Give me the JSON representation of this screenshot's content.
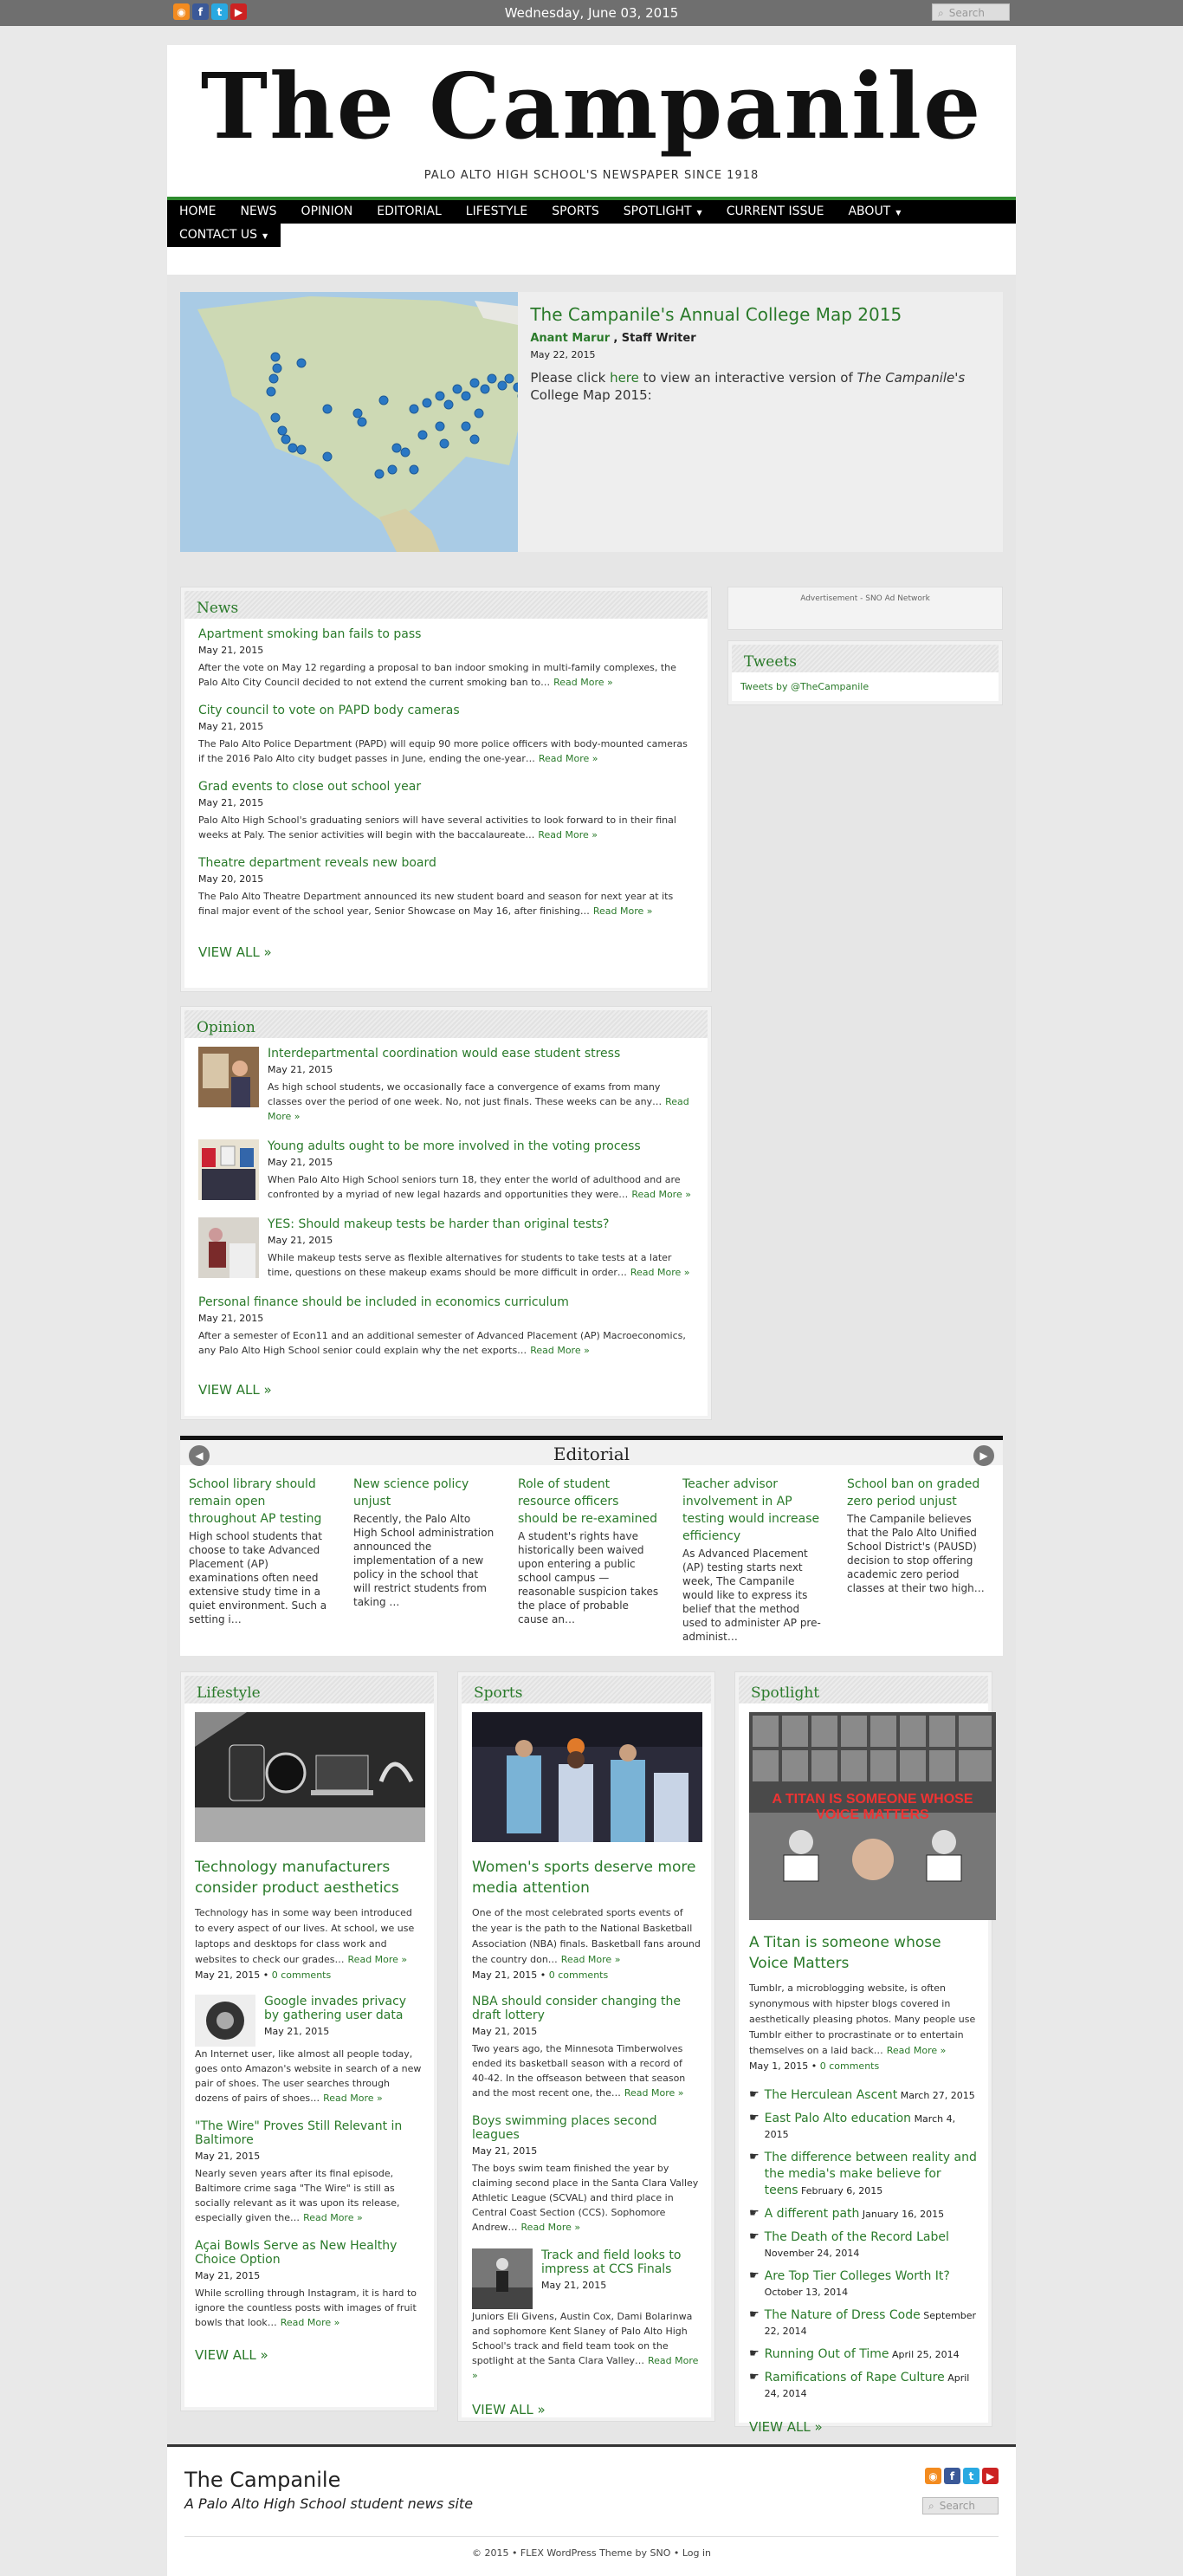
{
  "topbar": {
    "date": "Wednesday, June 03, 2015",
    "search_placeholder": "Search"
  },
  "site": {
    "title": "The Campanile",
    "tagline": "PALO ALTO HIGH SCHOOL'S NEWSPAPER SINCE 1918"
  },
  "nav": {
    "items": [
      "HOME",
      "NEWS",
      "OPINION",
      "EDITORIAL",
      "LIFESTYLE",
      "SPORTS",
      "SPOTLIGHT",
      "CURRENT ISSUE",
      "ABOUT",
      "CONTACT US"
    ]
  },
  "feature": {
    "title": "The Campanile's Annual College Map 2015",
    "author": "Anant Marur",
    "role": "Staff Writer",
    "date": "May 22, 2015",
    "body_pre": "Please click",
    "body_link": "here",
    "body_mid": "to view an interactive version of",
    "body_italic": "The Campanile's",
    "body_post": "College Map 2015:"
  },
  "news": {
    "header": "News",
    "articles": [
      {
        "title": "Apartment smoking ban fails to pass",
        "date": "May 21, 2015",
        "excerpt": "After the vote on May 12 regarding a proposal to ban indoor smoking in multi-family complexes, the Palo Alto City Council decided to not extend the current smoking ban to…"
      },
      {
        "title": "City council to vote on PAPD body cameras",
        "date": "May 21, 2015",
        "excerpt": "The Palo Alto Police Department (PAPD) will equip 90 more police officers with body-mounted cameras if the 2016 Palo Alto city budget passes in June, ending the one-year…"
      },
      {
        "title": "Grad events to close out school year",
        "date": "May 21, 2015",
        "excerpt": "Palo Alto High School's graduating seniors will have several activities to look forward to in their final weeks at Paly. The senior activities will begin with the baccalaureate…"
      },
      {
        "title": "Theatre department reveals new board",
        "date": "May 20, 2015",
        "excerpt": "The Palo Alto Theatre Department announced its new student board and season for next year at its final major event of the school year, Senior Showcase on May 16, after finishing…"
      }
    ]
  },
  "opinion": {
    "header": "Opinion",
    "articles": [
      {
        "title": "Interdepartmental coordination would ease student stress",
        "date": "May 21, 2015",
        "excerpt": "As high school students, we occasionally face a convergence of exams from many classes over the period of one week. No, not just finals. These weeks can be any…"
      },
      {
        "title": "Young adults ought to be more involved in the voting process",
        "date": "May 21, 2015",
        "excerpt": "When Palo Alto High School seniors turn 18, they enter the world of adulthood and are confronted by a myriad of new legal hazards and opportunities they were…"
      },
      {
        "title": "YES: Should makeup tests be harder than original tests?",
        "date": "May 21, 2015",
        "excerpt": "While makeup tests serve as flexible alternatives for students to take tests at a later time, questions on these makeup exams should be more difficult in order…"
      },
      {
        "title": "Personal finance should be included in economics curriculum",
        "date": "May 21, 2015",
        "excerpt": "After a semester of Econ11 and an additional semester of Advanced Placement (AP) Macroeconomics, any Palo Alto High School senior could explain why the net exports…"
      }
    ]
  },
  "sidebar": {
    "ad_label": "Advertisement - SNO Ad Network",
    "tweets_header": "Tweets",
    "tweets_link": "Tweets by @TheCampanile"
  },
  "common": {
    "read_more": "Read More »",
    "view_all": "VIEW ALL »",
    "comments": "0 comments"
  },
  "editorial": {
    "header": "Editorial",
    "items": [
      {
        "title": "School library should remain open throughout AP testing",
        "excerpt": "High school students that choose to take Advanced Placement (AP) examinations often need extensive study time in a quiet environment. Such a setting i…"
      },
      {
        "title": "New science policy unjust",
        "excerpt": "Recently, the Palo Alto High School administration announced the implementation of a new policy in the school that will restrict students from taking …"
      },
      {
        "title": "Role of student resource officers should be re-examined",
        "excerpt": "A student's rights have historically been waived upon entering a public school campus — reasonable suspicion takes the place of probable cause an…"
      },
      {
        "title": "Teacher advisor involvement in AP testing would increase efficiency",
        "excerpt": "As Advanced Placement (AP) testing starts next week, The Campanile would like to express its belief that the method used to administer AP pre-administ…"
      },
      {
        "title": "School ban on graded zero period unjust",
        "excerpt": "The Campanile believes that the Palo Alto Unified School District's (PAUSD) decision to stop offering academic zero period classes at their two high…"
      }
    ]
  },
  "lifestyle": {
    "header": "Lifestyle",
    "lead": {
      "title": "Technology manufacturers consider product aesthetics",
      "excerpt": "Technology has in some way been introduced to every aspect of our lives. At school, we use laptops and desktops for class work and websites to check our grades…",
      "date": "May 21, 2015"
    },
    "items": [
      {
        "title": "Google invades privacy by gathering user data",
        "date": "May 21, 2015",
        "excerpt": "An Internet user, like almost all people today, goes onto Amazon's website in search of a new pair of shoes. The user searches through dozens of pairs of shoes…"
      },
      {
        "title": "\"The Wire\" Proves Still Relevant in Baltimore",
        "date": "May 21, 2015",
        "excerpt": "Nearly seven years after its final episode, Baltimore crime saga \"The Wire\" is still as socially relevant as it was upon its release, especially given the…"
      },
      {
        "title": "Açai Bowls Serve as New Healthy Choice Option",
        "date": "May 21, 2015",
        "excerpt": "While scrolling through  Instagram, it is hard to ignore the countless posts with images of fruit bowls that look…"
      }
    ]
  },
  "sports": {
    "header": "Sports",
    "lead": {
      "title": "Women's sports deserve more media attention",
      "excerpt": "One of the most celebrated sports events of the year is the path to the National Basketball Association (NBA) finals. Basketball fans around the country don…",
      "date": "May 21, 2015"
    },
    "items": [
      {
        "title": "NBA should consider changing the draft lottery",
        "date": "May 21, 2015",
        "excerpt": "Two years ago, the Minnesota Timberwolves ended its basketball season with a record of 40-42. In the offseason between that season and the most recent one, the…"
      },
      {
        "title": "Boys swimming places second leagues",
        "date": "May 21, 2015",
        "excerpt": "The boys swim team finished the year by claiming second place in the Santa Clara Valley Athletic League (SCVAL) and third place in Central Coast Section (CCS). Sophomore Andrew…"
      },
      {
        "title": "Track and field looks to impress at CCS Finals",
        "date": "May 21, 2015",
        "excerpt": "Juniors Eli Givens, Austin Cox, Dami Bolarinwa and sophomore Kent Slaney of Palo Alto High School's track and field team took on the spotlight at the Santa Clara Valley…"
      }
    ]
  },
  "spotlight": {
    "header": "Spotlight",
    "image_headline": "A TITAN IS SOMEONE WHOSE VOICE MATTERS",
    "lead": {
      "title": "A Titan is someone whose Voice Matters",
      "excerpt": "Tumblr, a microblogging website, is often synonymous with hipster blogs covered in aesthetically pleasing photos. Many people use Tumblr either to procrastinate or to entertain themselves on a laid back…",
      "date": "May 1, 2015"
    },
    "links": [
      {
        "title": "The Herculean Ascent",
        "date": "March 27, 2015"
      },
      {
        "title": "East Palo Alto education",
        "date": "March 4, 2015"
      },
      {
        "title": "The difference between reality and the media's make believe for teens",
        "date": "February 6, 2015"
      },
      {
        "title": "A different path",
        "date": "January 16, 2015"
      },
      {
        "title": "The Death of the Record Label",
        "date": "November 24, 2014"
      },
      {
        "title": "Are Top Tier Colleges Worth It?",
        "date": "October 13, 2014"
      },
      {
        "title": "The Nature of Dress Code",
        "date": "September 22, 2014"
      },
      {
        "title": "Running Out of Time",
        "date": "April 25, 2014"
      },
      {
        "title": "Ramifications of Rape Culture",
        "date": "April 24, 2014"
      }
    ]
  },
  "footer": {
    "site": "The Campanile",
    "desc": "A Palo Alto High School student news site",
    "search_placeholder": "Search",
    "copyright": "© 2015 • FLEX WordPress Theme by SNO • Log in"
  },
  "colors": {
    "accent": "#2a7a2a",
    "nav_bg": "#000000",
    "topbar_bg": "#6f6f6f"
  }
}
